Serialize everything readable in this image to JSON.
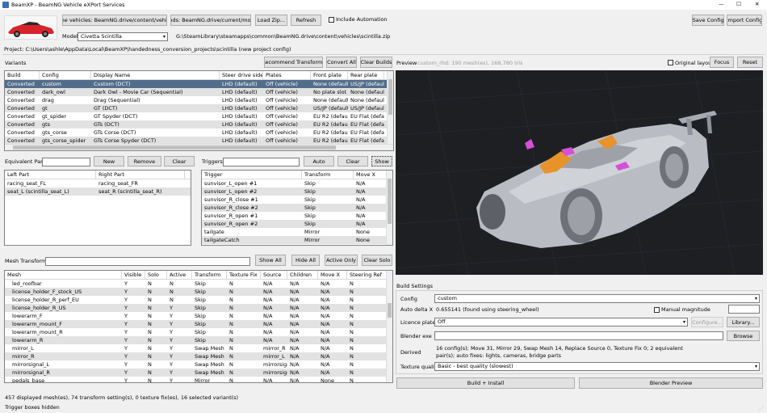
{
  "window": {
    "title": "BeamXP - BeamNG Vehicle eXPort Services"
  },
  "titlebar": {
    "minimize": "—",
    "maximize": "☐",
    "close": "✕"
  },
  "top": {
    "game_vehicles_btn": "Game vehicles: BeamNG.drive/content/vehicles",
    "mods_btn": "Mods: BeamNG.drive/current/mods",
    "load_zip_btn": "Load Zip...",
    "refresh_btn": "Refresh",
    "include_automation": "Include Automation",
    "save_config_btn": "Save Config",
    "import_config_btn": "Import Config",
    "model_label": "Model",
    "model_value": "Civetta Scintilla",
    "model_path": "G:\\SteamLibrary\\steamapps\\common\\BeamNG.drive\\content\\vehicles\\scintilla.zip",
    "project_path": "Project: C:\\Users\\ashle\\AppData\\Local\\BeamXP\\handedness_conversion_projects\\scintilla (new project config)"
  },
  "variants": {
    "label": "Variants",
    "recommend_btn": "Recommend Transforms",
    "convert_all_btn": "Convert All",
    "clear_builds_btn": "Clear Builds",
    "columns": [
      "Build",
      "Config",
      "Display Name",
      "Steer drive side",
      "Plates",
      "Front plate",
      "Rear plate"
    ],
    "rows": [
      [
        "Converted",
        "custom",
        "Custom (DCT)",
        "LHD (default)",
        "Off (vehicle)",
        "None (default)",
        "US/JP (default"
      ],
      [
        "Converted",
        "dark_owl",
        "Dark Owl - Movie Car (Sequential)",
        "LHD (default)",
        "Off (vehicle)",
        "No plate slot (de",
        "None (default)"
      ],
      [
        "Converted",
        "drag",
        "Drag (Sequential)",
        "LHD (default)",
        "Off (vehicle)",
        "None (default)",
        "None (default)"
      ],
      [
        "Converted",
        "gt",
        "GT (DCT)",
        "LHD (default)",
        "Off (vehicle)",
        "US/JP (default)",
        "US/JP (default"
      ],
      [
        "Converted",
        "gt_spider",
        "GT Spyder (DCT)",
        "LHD (default)",
        "Off (vehicle)",
        "EU R2 (default)",
        "EU Flat (defau"
      ],
      [
        "Converted",
        "gts",
        "GTs (DCT)",
        "LHD (default)",
        "Off (vehicle)",
        "EU R2 (default)",
        "EU Flat (defau"
      ],
      [
        "Converted",
        "gts_corse",
        "GTs Corse (DCT)",
        "LHD (default)",
        "Off (vehicle)",
        "EU R2 (default)",
        "EU Flat (defau"
      ],
      [
        "Converted",
        "gts_corse_spider",
        "GTs Corse Spyder (DCT)",
        "LHD (default)",
        "Off (vehicle)",
        "EU R2 (default)",
        "EU Flat (defau"
      ]
    ]
  },
  "equiv": {
    "label": "Equivalent Parts",
    "new_btn": "New",
    "remove_btn": "Remove",
    "clear_btn": "Clear",
    "columns": [
      "Left Part",
      "Right Part"
    ],
    "rows": [
      [
        "racing_seat_FL",
        "racing_seat_FR"
      ],
      [
        "seat_L (scintilla_seat_L)",
        "seat_R (scintilla_seat_R)"
      ]
    ]
  },
  "triggers": {
    "label": "Triggers",
    "auto_btn": "Auto",
    "clear_btn": "Clear",
    "show_btn": "Show",
    "columns": [
      "Trigger",
      "Transform",
      "Move X"
    ],
    "rows": [
      [
        "sunvisor_L_open #1",
        "Skip",
        "N/A"
      ],
      [
        "sunvisor_L_open #2",
        "Skip",
        "N/A"
      ],
      [
        "sunvisor_R_close #1",
        "Skip",
        "N/A"
      ],
      [
        "sunvisor_R_close #2",
        "Skip",
        "N/A"
      ],
      [
        "sunvisor_R_open #1",
        "Skip",
        "N/A"
      ],
      [
        "sunvisor_R_open #2",
        "Skip",
        "N/A"
      ],
      [
        "tailgate",
        "Mirror",
        "None"
      ],
      [
        "tailgateCatch",
        "Mirror",
        "None"
      ]
    ]
  },
  "mesh": {
    "label": "Mesh Transforms",
    "show_all_btn": "Show All",
    "hide_all_btn": "Hide All",
    "active_only_btn": "Active Only",
    "clear_solo_btn": "Clear Solo",
    "columns": [
      "Mesh",
      "Visible",
      "Solo",
      "Active",
      "Transform",
      "Texture Fix",
      "Source",
      "Children",
      "Move X",
      "Steering Ref"
    ],
    "rows": [
      [
        "led_roofbar",
        "Y",
        "N",
        "N",
        "Skip",
        "N",
        "N/A",
        "N/A",
        "N/A",
        "N"
      ],
      [
        "license_holder_F_stock_US",
        "Y",
        "N",
        "N",
        "Skip",
        "N",
        "N/A",
        "N/A",
        "N/A",
        "N"
      ],
      [
        "license_holder_R_perf_EU",
        "Y",
        "N",
        "N",
        "Skip",
        "N",
        "N/A",
        "N/A",
        "N/A",
        "N"
      ],
      [
        "license_holder_R_US",
        "Y",
        "N",
        "Y",
        "Skip",
        "N",
        "N/A",
        "N/A",
        "N/A",
        "N"
      ],
      [
        "lowerarm_F",
        "Y",
        "N",
        "Y",
        "Skip",
        "N",
        "N/A",
        "N/A",
        "N/A",
        "N"
      ],
      [
        "lowerarm_mount_F",
        "Y",
        "N",
        "Y",
        "Skip",
        "N",
        "N/A",
        "N/A",
        "N/A",
        "N"
      ],
      [
        "lowerarm_mount_R",
        "Y",
        "N",
        "Y",
        "Skip",
        "N",
        "N/A",
        "N/A",
        "N/A",
        "N"
      ],
      [
        "lowerarm_R",
        "Y",
        "N",
        "Y",
        "Skip",
        "N",
        "N/A",
        "N/A",
        "N/A",
        "N"
      ],
      [
        "mirror_L",
        "Y",
        "N",
        "Y",
        "Swap Mesh",
        "N",
        "mirror_R",
        "N/A",
        "N/A",
        "N"
      ],
      [
        "mirror_R",
        "Y",
        "N",
        "Y",
        "Swap Mesh",
        "N",
        "mirror_L",
        "N/A",
        "N/A",
        "N"
      ],
      [
        "mirrorsignal_L",
        "Y",
        "N",
        "Y",
        "Swap Mesh",
        "N",
        "mirrorsignz",
        "N/A",
        "N/A",
        "N"
      ],
      [
        "mirrorsignal_R",
        "Y",
        "N",
        "Y",
        "Swap Mesh",
        "N",
        "mirrorsignz",
        "N/A",
        "N/A",
        "N"
      ],
      [
        "pedals_base",
        "Y",
        "N",
        "Y",
        "Mirror",
        "N",
        "N/A",
        "N/A",
        "None",
        "N"
      ]
    ]
  },
  "status": {
    "line1": "457 displayed mesh(es), 74 transform setting(s), 0 texture fix(es), 16 selected variant(s)",
    "line2": "Trigger boxes hidden"
  },
  "preview": {
    "label": "Preview",
    "info": "custom_rhd: 190 mesh(es), 168,780 tris",
    "original_layout": "Original layout",
    "focus_btn": "Focus",
    "reset_btn": "Reset"
  },
  "build": {
    "label": "Build Settings",
    "config_label": "Config",
    "config_value": "custom",
    "auto_delta_label": "Auto delta X",
    "auto_delta_value": "0.655141 (found using steering_wheel)",
    "manual_magnitude": "Manual magnitude",
    "licence_label": "Licence plates",
    "licence_value": "Off",
    "configure_btn": "Configure...",
    "library_btn": "Library...",
    "blender_exe_label": "Blender exe",
    "browse_btn": "Browse",
    "derived_label": "Derived",
    "derived_value": "16 config(s); Move 31, Mirror 29, Swap Mesh 14, Replace Source 0, Texture Fix 0; 2 equivalent pair(s); auto fixes: lights, cameras, bridge parts",
    "texture_label": "Texture quality",
    "texture_value": "Basic - best quality (slowest)",
    "build_install_btn": "Build + Install",
    "blender_preview_btn": "Blender Preview"
  },
  "colors": {
    "selection": "#526d8c",
    "viewport_bg": "#1d1f23",
    "accent_orange": "#e8922a",
    "accent_magenta": "#d64fd6",
    "car_red": "#d8232a"
  }
}
